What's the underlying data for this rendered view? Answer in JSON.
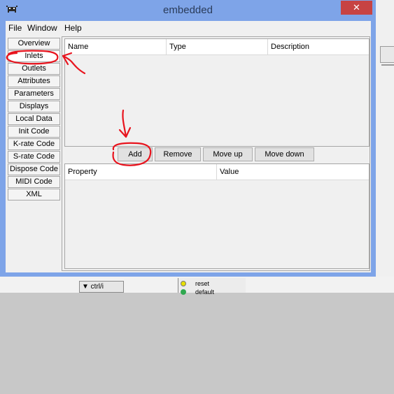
{
  "window": {
    "title": "embedded",
    "close_glyph": "✕"
  },
  "menubar": {
    "items": [
      "File",
      "Window",
      "Help"
    ]
  },
  "sidebar": {
    "tabs": [
      "Overview",
      "Inlets",
      "Outlets",
      "Attributes",
      "Parameters",
      "Displays",
      "Local Data",
      "Init Code",
      "K-rate Code",
      "S-rate Code",
      "Dispose Code",
      "MIDI Code",
      "XML"
    ],
    "selected": "Inlets"
  },
  "inlets_table": {
    "columns": [
      "Name",
      "Type",
      "Description"
    ]
  },
  "buttons": {
    "add": "Add",
    "remove": "Remove",
    "move_up": "Move up",
    "move_down": "Move down"
  },
  "properties_table": {
    "columns": [
      "Property",
      "Value"
    ]
  },
  "background_app": {
    "toggle_label": "▼ ctrl/i",
    "node_items": [
      "reset",
      "default"
    ]
  },
  "annotation": {
    "color": "#e8141e"
  }
}
